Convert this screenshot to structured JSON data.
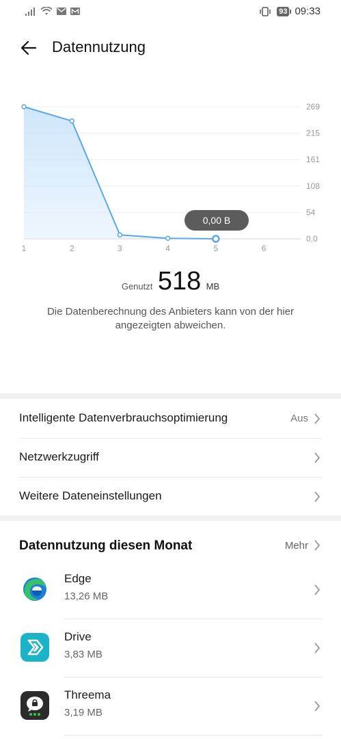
{
  "status_bar": {
    "battery": "93",
    "time": "09:33"
  },
  "header": {
    "title": "Datennutzung"
  },
  "chart_data": {
    "type": "area",
    "x": [
      1,
      2,
      3,
      4,
      5,
      6
    ],
    "values": [
      269,
      240,
      8,
      1,
      0
    ],
    "y_ticks": [
      "269",
      "215",
      "161",
      "108",
      "54",
      "0,0"
    ],
    "x_ticks": [
      "1",
      "2",
      "3",
      "4",
      "5",
      "6"
    ],
    "ylim": [
      0,
      269
    ],
    "selected_index": 4,
    "tooltip": "0,00 B",
    "line_color": "#5aa9e6",
    "fill_color": "#cfe6fb"
  },
  "usage": {
    "label": "Genutzt",
    "value": "518",
    "unit": "MB"
  },
  "note": "Die Datenberechnung des Anbieters kann von der hier angezeigten abweichen.",
  "settings": [
    {
      "label": "Intelligente Datenverbrauchsoptimierung",
      "value": "Aus"
    },
    {
      "label": "Netzwerkzugriff",
      "value": ""
    },
    {
      "label": "Weitere Dateneinstellungen",
      "value": ""
    }
  ],
  "monthly": {
    "title": "Datennutzung diesen Monat",
    "more": "Mehr",
    "apps": [
      {
        "name": "Edge",
        "size": "13,26 MB",
        "icon": "edge-icon"
      },
      {
        "name": "Drive",
        "size": "3,83 MB",
        "icon": "drive-icon"
      },
      {
        "name": "Threema",
        "size": "3,19 MB",
        "icon": "threema-icon"
      }
    ]
  }
}
